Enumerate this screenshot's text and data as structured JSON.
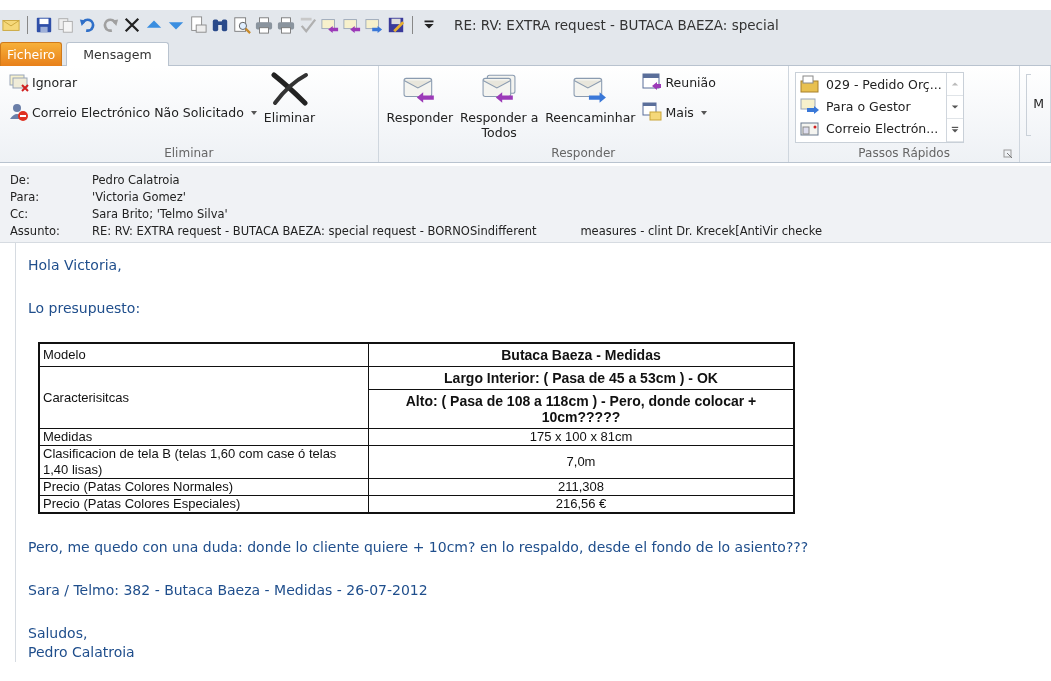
{
  "window": {
    "title": "RE: RV: EXTRA request - BUTACA BAEZA: special"
  },
  "tabs": [
    {
      "label": "Ficheiro",
      "kind": "file",
      "selected": false
    },
    {
      "label": "Mensagem",
      "kind": "tab",
      "selected": true
    }
  ],
  "ribbon": {
    "delete_group": {
      "label": "Eliminar",
      "ignore": "Ignorar",
      "junk": "Correio Electrónico Não Solicitado",
      "delete": "Eliminar"
    },
    "respond_group": {
      "label": "Responder",
      "reply": "Responder",
      "reply_all": "Responder a Todos",
      "forward": "Reencaminhar",
      "meeting": "Reunião",
      "more": "Mais"
    },
    "quick_steps": {
      "label": "Passos Rápidos",
      "items": [
        "029 - Pedido Orç...",
        "Para o Gestor",
        "Correio Electrón..."
      ]
    },
    "next_group": {
      "label": "M"
    }
  },
  "header": [
    {
      "label": "De:",
      "value": "Pedro Calatroia"
    },
    {
      "label": "Para:",
      "value": "'Victoria Gomez'"
    },
    {
      "label": "Cc:",
      "value": "Sara Brito; 'Telmo Silva'"
    },
    {
      "label": "Assunto:",
      "value": "RE: RV: EXTRA request - BUTACA BAEZA: special request - BORNOSindifferent            measures - clint Dr. Krecek[AntiVir checke"
    }
  ],
  "body": {
    "greeting": "Hola Victoria,",
    "intro": "Lo presupuesto:",
    "table": [
      {
        "label": "Modelo",
        "values": [
          "Butaca Baeza - Medidas"
        ],
        "bold": true
      },
      {
        "label": "Caracterisitcas",
        "values": [
          "Largo Interior: ( Pasa de 45 a 53cm ) - OK",
          "Alto: ( Pasa de 108 a 118cm ) - Pero, donde colocar + 10cm?????"
        ],
        "bold": true
      },
      {
        "label": "Medidas",
        "values": [
          "175 x 100 x 81cm"
        ],
        "bold": false
      },
      {
        "label": "Clasificacion de tela B (telas 1,60 com case ó telas 1,40 lisas)",
        "values": [
          "7,0m"
        ],
        "bold": false
      },
      {
        "label": "Precio (Patas Colores Normales)",
        "values": [
          "211,308"
        ],
        "bold": false
      },
      {
        "label": "Precio (Patas Colores Especiales)",
        "values": [
          "216,56 €"
        ],
        "bold": false
      }
    ],
    "after": [
      "Pero, me quedo con una duda: donde lo cliente quiere + 10cm? en lo respaldo, desde el fondo de lo asiento???",
      "Sara / Telmo: 382 - Butaca Baeza - Medidas - 26-07-2012"
    ],
    "signature": [
      "Saludos,",
      "Pedro Calatroia"
    ]
  }
}
